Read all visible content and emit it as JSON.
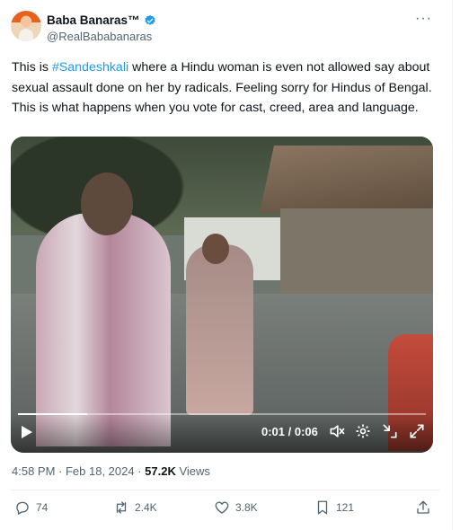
{
  "author": {
    "name": "Baba Banaras™",
    "handle": "@RealBababanaras"
  },
  "tweet": {
    "text_before": "This is ",
    "hashtag": "#Sandeshkali",
    "text_after": " where a Hindu woman is even not allowed say about sexual assault done on her by radicals. Feeling sorry for Hindus of Bengal. This is what happens when you vote for cast, creed, area and language."
  },
  "video": {
    "time": "0:01 / 0:06",
    "progress": 0.17
  },
  "meta": {
    "timestamp": "4:58 PM · Feb 18, 2024 · ",
    "views_count": "57.2K",
    "views_label": " Views"
  },
  "actions": {
    "replies": "74",
    "reposts": "2.4K",
    "likes": "3.8K",
    "bookmarks": "121"
  },
  "colors": {
    "accent": "#1d9bf0",
    "muted": "#536471"
  },
  "icons": [
    "verified-badge-icon",
    "more-icon",
    "play-icon",
    "volume-icon",
    "settings-icon",
    "minimize-icon",
    "fullscreen-icon",
    "reply-icon",
    "repost-icon",
    "like-icon",
    "bookmark-icon",
    "share-icon"
  ]
}
